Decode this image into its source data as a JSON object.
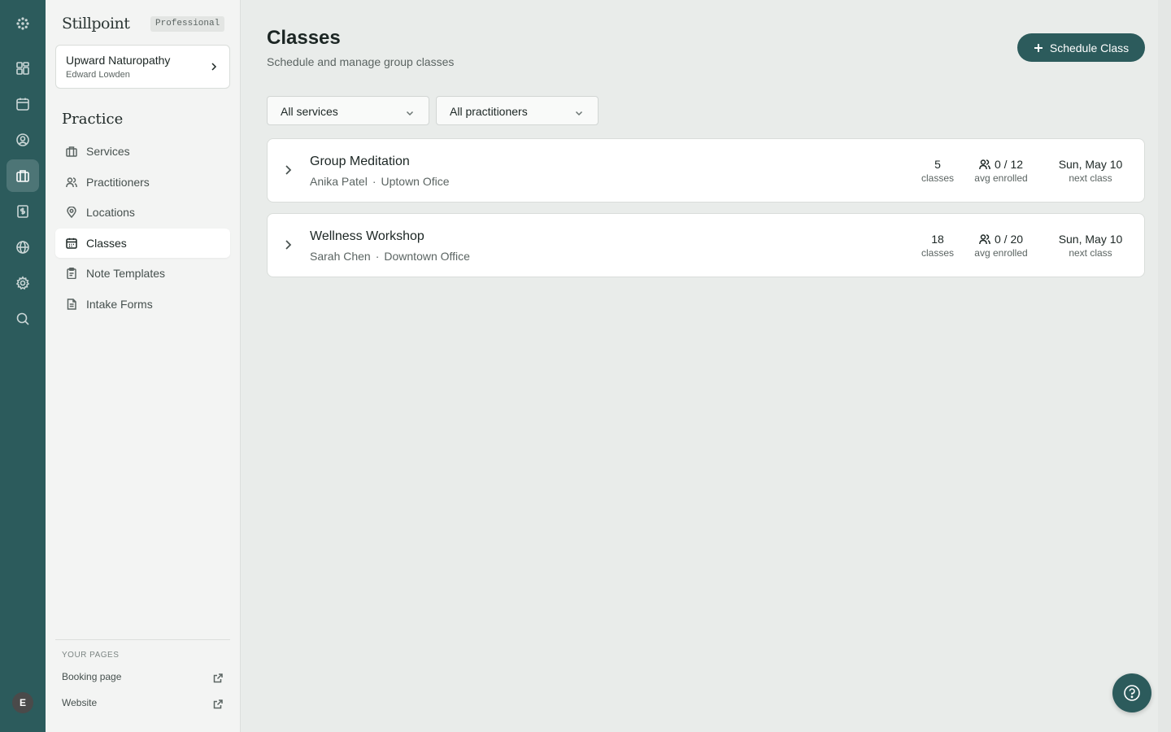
{
  "colors": {
    "accent": "#2c5b5c",
    "sidebar_bg": "#f3f4f3",
    "main_bg": "#e9ecea",
    "card_bg": "#ffffff"
  },
  "rail": {
    "items": [
      {
        "icon": "logo-icon"
      },
      {
        "icon": "dashboard-icon"
      },
      {
        "icon": "calendar-icon"
      },
      {
        "icon": "client-icon"
      },
      {
        "icon": "practice-briefcase-icon",
        "active": true
      },
      {
        "icon": "billing-icon"
      },
      {
        "icon": "globe-icon"
      },
      {
        "icon": "settings-gear-icon"
      },
      {
        "icon": "search-icon"
      }
    ],
    "avatar_initial": "E"
  },
  "sidebar": {
    "brand": "Stillpoint",
    "plan_badge": "Professional",
    "org": {
      "name": "Upward Naturopathy",
      "user": "Edward Lowden"
    },
    "section_title": "Practice",
    "items": [
      {
        "label": "Services",
        "icon": "briefcase-icon"
      },
      {
        "label": "Practitioners",
        "icon": "users-icon"
      },
      {
        "label": "Locations",
        "icon": "map-pin-icon"
      },
      {
        "label": "Classes",
        "icon": "calendar-icon",
        "active": true
      },
      {
        "label": "Note Templates",
        "icon": "clipboard-icon"
      },
      {
        "label": "Intake Forms",
        "icon": "document-icon"
      }
    ],
    "pages_label": "YOUR PAGES",
    "pages": [
      {
        "label": "Booking page",
        "icon": "external-link-icon"
      },
      {
        "label": "Website",
        "icon": "external-link-icon"
      }
    ]
  },
  "main": {
    "title": "Classes",
    "subtitle": "Schedule and manage group classes",
    "primary_button": "Schedule Class",
    "filters": [
      {
        "value": "All services"
      },
      {
        "value": "All practitioners"
      }
    ],
    "classes": [
      {
        "name": "Group Meditation",
        "practitioner": "Anika Patel",
        "location": "Uptown Ofice",
        "count": "5",
        "count_label": "classes",
        "enrolled": "0 / 12",
        "enrolled_label": "avg enrolled",
        "next": "Sun, May 10",
        "next_label": "next class"
      },
      {
        "name": "Wellness Workshop",
        "practitioner": "Sarah Chen",
        "location": "Downtown Office",
        "count": "18",
        "count_label": "classes",
        "enrolled": "0 / 20",
        "enrolled_label": "avg enrolled",
        "next": "Sun, May 10",
        "next_label": "next class"
      }
    ],
    "meta_separator": "·"
  }
}
